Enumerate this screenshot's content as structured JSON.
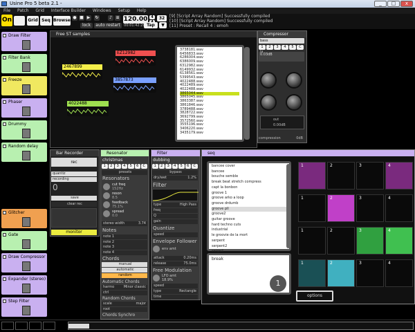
{
  "window": {
    "title": "Usine Pro 5 beta 2.1 -",
    "min": "_",
    "max": "□",
    "close": "x"
  },
  "menu": [
    "File",
    "Patch",
    "Grid",
    "Interface Builder",
    "Windows",
    "Setup",
    "Help"
  ],
  "toolbar": {
    "on": "On",
    "grid": "Grid",
    "seq": "Seq",
    "browser": "Browser",
    "lock": "lock",
    "auto_restart": "auto restart",
    "tempo": "120.00",
    "tempo_sub": "00:01:42:200",
    "sig_top": "4",
    "sig_bottom": "4",
    "tap": "Tap",
    "sig2": "32"
  },
  "log": [
    "[9] [Script Array Random] Successfully compiled",
    "[10] [Script Array Random] Successfully compiled",
    "[11] Preset : Recall 4 : emoh"
  ],
  "sidebar": [
    {
      "label": "Draw Filter",
      "color": "#c9b0f0"
    },
    {
      "label": "Filter Bank",
      "color": "#b8f0b0"
    },
    {
      "label": "Freeze",
      "color": "#f0e860"
    },
    {
      "label": "Phaser",
      "color": "#c9b0f0"
    },
    {
      "label": "Drummy",
      "color": "#b8f0b0"
    },
    {
      "label": "Random delay",
      "color": "#b8f0b0"
    },
    {
      "label": "Glitcher",
      "color": "#f0a050"
    },
    {
      "label": "Gate",
      "color": "#b8f0b0"
    },
    {
      "label": "Draw Compressor",
      "color": "#c9b0f0"
    },
    {
      "label": "Expander (stereo)",
      "color": "#c9b0f0"
    },
    {
      "label": "Step Filter",
      "color": "#c9b0f0"
    }
  ],
  "samples": {
    "title": "Free ST samples",
    "waves": [
      {
        "name": "2467899",
        "color": "#f5ef4a"
      },
      {
        "name": "EZ12982",
        "color": "#f05050"
      },
      {
        "name": "3857873",
        "color": "#7aa0ff"
      },
      {
        "name": "4022488",
        "color": "#9fe050"
      }
    ],
    "files": [
      "3738181.wav",
      "6456833.wav",
      "6286004.wav",
      "6386009.wav",
      "6312982.wav",
      "6149932.wav",
      "6138561.wav",
      "5399543.wav",
      "4022488.wav",
      "4022489.wav",
      "4022488.wav",
      "3865044.wav",
      "3865045.wav",
      "3863387.wav",
      "3861846.wav",
      "3789488.wav",
      "3828722.wav",
      "3692799.wav",
      "3572560.wav",
      "3555196.wav",
      "3406220.wav",
      "3435179.wav"
    ],
    "selected_index": 11
  },
  "compressor": {
    "title": "Compressor",
    "preset": "bass",
    "row1": [
      "1",
      "2",
      "3",
      "4",
      "5",
      "C"
    ],
    "lookahead": "la",
    "value": "0.03dB",
    "knob_labels": [
      "ratio",
      "gain",
      "att",
      "rel",
      "knee",
      "mix"
    ],
    "out_label": "out",
    "out_val": "0.00dB",
    "footer": "compression",
    "footer_val": "0dB"
  },
  "barrecorder": {
    "title": "Bar Recorder",
    "rec": "rec",
    "quantiz": "quantiz",
    "recording": "recording",
    "count": "0",
    "save": "save",
    "clear": "clear rec",
    "monitor": "monitor"
  },
  "resonator": {
    "title": "Resonator",
    "preset": "christmas",
    "nums": [
      "1",
      "2",
      "3",
      "4",
      "5",
      "6",
      "C"
    ],
    "sub": "presets",
    "sec_reson": "Resonators",
    "items": [
      {
        "label": "cut freq",
        "value": "152Hz"
      },
      {
        "label": "reson",
        "value": "8.5"
      },
      {
        "label": "feedback",
        "value": "75.1%"
      },
      {
        "label": "spread",
        "value": "0.0"
      }
    ],
    "stereo": "stereo width",
    "stereo_val": "3.74",
    "notes": "Notes",
    "notes_list": [
      "note 1",
      "note 2",
      "note 3",
      "note 4"
    ],
    "chords": "Chords",
    "modes": [
      "manual",
      "automatic",
      "random"
    ],
    "auto_chords": "Automatic Chords",
    "harmo": "harmo",
    "harmo_val": "Minor classic",
    "ctrl": "ctrl",
    "root": "root",
    "random_chords": "Random Chords",
    "scale": "scale",
    "scale_val": "major",
    "root2": "root",
    "chords_synchro": "Chords Synchro"
  },
  "filter": {
    "title": "Filter",
    "preset": "dubbing",
    "nums": [
      "1",
      "2",
      "3",
      "4",
      "5",
      "6",
      "C"
    ],
    "bypass": "bypass",
    "drywet": "dry/wet",
    "drywet_val": "1.2%",
    "filter_sec": "Filter",
    "type": "type",
    "type_val": "High Pass",
    "frequency": "freq",
    "q": "Q",
    "gain": "gain",
    "envelope": "Envelope Follower",
    "env_amt": "env amt",
    "speed": "speed",
    "attack": "attack",
    "attack_val": "0.20ms",
    "release": "release",
    "release_val": "75.0ms",
    "quantize": "Quantize",
    "fm": "Free Modulation",
    "lfo": "LFO amt",
    "lfo_val": "18.9%",
    "fm_speed": "speed",
    "fm_type": "type",
    "fm_type_val": "Rectangle",
    "fm_time": "time"
  },
  "seq": {
    "title": "seq",
    "songs": [
      "bancee cover",
      "bancee",
      "bouche semble",
      "break beat stretch compress",
      "capt la bonbon",
      "groove 1",
      "groove arko a loop",
      "groove drdumb",
      "groove pll",
      "groove2",
      "guitar groove",
      "hard techno cuts",
      "industrial",
      "le groovie de la mort",
      "serpent",
      "serpent2",
      "sergo2"
    ],
    "selected": 8,
    "bottom_label": "break",
    "big_num": "1",
    "options": "options"
  },
  "pads": [
    {
      "n": "1",
      "c": "#7a2a7e"
    },
    {
      "n": "2",
      "c": "#0a0a0a"
    },
    {
      "n": "3",
      "c": "#0a0a0a"
    },
    {
      "n": "4",
      "c": "#7a2a7e"
    },
    {
      "n": "1",
      "c": "#0a0a0a"
    },
    {
      "n": "2",
      "c": "#c040c8"
    },
    {
      "n": "3",
      "c": "#0a0a0a"
    },
    {
      "n": "4",
      "c": "#0a0a0a"
    },
    {
      "n": "1",
      "c": "#0a0a0a"
    },
    {
      "n": "2",
      "c": "#0a0a0a"
    },
    {
      "n": "3",
      "c": "#30a040"
    },
    {
      "n": "4",
      "c": "#40c050"
    },
    {
      "n": "1",
      "c": "#1a5055"
    },
    {
      "n": "2",
      "c": "#40b0c0"
    },
    {
      "n": "3",
      "c": "#0a0a0a"
    },
    {
      "n": "4",
      "c": "#0a0a0a"
    }
  ]
}
